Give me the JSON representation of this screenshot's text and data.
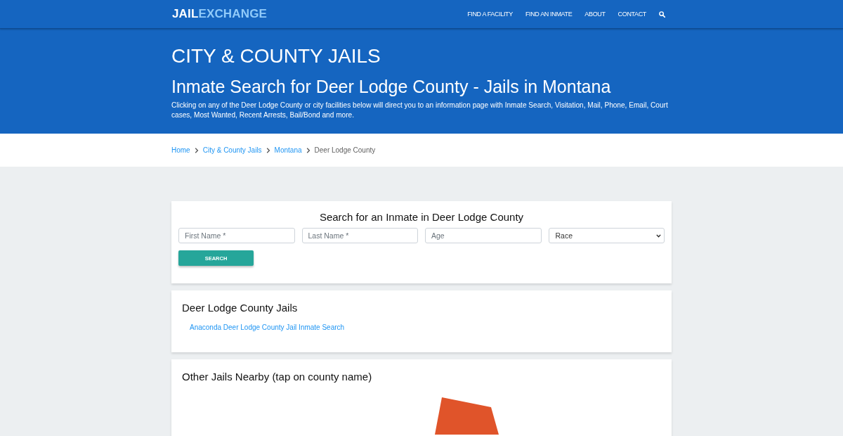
{
  "header": {
    "logo": {
      "words": [
        "JAIL",
        "EXCHANGE"
      ]
    },
    "nav": [
      "FIND A FACILITY",
      "FIND AN INMATE",
      "ABOUT",
      "CONTACT"
    ]
  },
  "hero": {
    "category": "CITY & COUNTY JAILS",
    "title": "Inmate Search for Deer Lodge County - Jails in Montana",
    "description": "Clicking on any of the Deer Lodge County or city facilities below will direct you to an information page with Inmate Search, Visitation, Mail, Phone, Email, Court cases, Most Wanted, Recent Arrests, Bail/Bond and more."
  },
  "breadcrumb": [
    {
      "label": "Home",
      "current": false
    },
    {
      "label": "City & County Jails",
      "current": false
    },
    {
      "label": "Montana",
      "current": false
    },
    {
      "label": "Deer Lodge County",
      "current": true
    }
  ],
  "search_card": {
    "title": "Search for an Inmate in Deer Lodge County",
    "fields": [
      {
        "kind": "input",
        "placeholder": "First Name *"
      },
      {
        "kind": "input",
        "placeholder": "Last Name *"
      },
      {
        "kind": "input",
        "placeholder": "Age"
      },
      {
        "kind": "select",
        "value": "Race"
      }
    ],
    "button": "SEARCH"
  },
  "jails_card": {
    "title": "Deer Lodge County Jails",
    "links": [
      "Anaconda Deer Lodge County Jail Inmate Search"
    ]
  },
  "nearby_card": {
    "title": "Other Jails Nearby (tap on county name)"
  }
}
